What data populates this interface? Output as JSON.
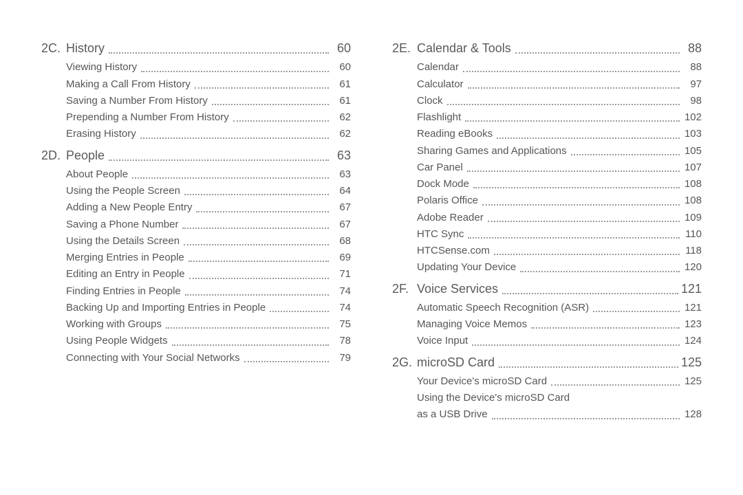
{
  "columns": [
    {
      "sections": [
        {
          "id": "2C.",
          "title": "History",
          "page": "60",
          "entries": [
            {
              "label": "Viewing History",
              "page": "60"
            },
            {
              "label": "Making a Call From History",
              "page": "61"
            },
            {
              "label": "Saving a Number From History",
              "page": "61"
            },
            {
              "label": "Prepending a Number From History",
              "page": "62"
            },
            {
              "label": "Erasing History",
              "page": "62"
            }
          ]
        },
        {
          "id": "2D.",
          "title": "People",
          "page": "63",
          "entries": [
            {
              "label": "About People",
              "page": "63"
            },
            {
              "label": "Using the People Screen",
              "page": "64"
            },
            {
              "label": "Adding a New People Entry",
              "page": "67"
            },
            {
              "label": "Saving a Phone Number",
              "page": "67"
            },
            {
              "label": "Using the Details Screen",
              "page": "68"
            },
            {
              "label": "Merging Entries in People",
              "page": "69"
            },
            {
              "label": "Editing an Entry in People",
              "page": "71"
            },
            {
              "label": "Finding Entries in People",
              "page": "74"
            },
            {
              "label": "Backing Up and Importing Entries in People",
              "page": "74"
            },
            {
              "label": "Working with Groups",
              "page": "75"
            },
            {
              "label": "Using People Widgets",
              "page": "78"
            },
            {
              "label": "Connecting with Your Social Networks",
              "page": "79"
            }
          ]
        }
      ]
    },
    {
      "sections": [
        {
          "id": "2E.",
          "title": "Calendar & Tools",
          "page": "88",
          "entries": [
            {
              "label": "Calendar",
              "page": "88"
            },
            {
              "label": "Calculator",
              "page": "97"
            },
            {
              "label": "Clock",
              "page": "98"
            },
            {
              "label": "Flashlight",
              "page": "102"
            },
            {
              "label": "Reading eBooks",
              "page": "103"
            },
            {
              "label": "Sharing Games and Applications",
              "page": "105"
            },
            {
              "label": "Car Panel",
              "page": "107"
            },
            {
              "label": "Dock Mode",
              "page": "108"
            },
            {
              "label": "Polaris Office",
              "page": "108"
            },
            {
              "label": "Adobe Reader",
              "page": "109"
            },
            {
              "label": "HTC Sync",
              "page": "110"
            },
            {
              "label": "HTCSense.com",
              "page": "118"
            },
            {
              "label": "Updating Your Device",
              "page": "120"
            }
          ]
        },
        {
          "id": "2F.",
          "title": "Voice Services",
          "page": "121",
          "entries": [
            {
              "label": "Automatic Speech Recognition (ASR)",
              "page": "121"
            },
            {
              "label": "Managing Voice Memos",
              "page": "123"
            },
            {
              "label": "Voice Input",
              "page": "124"
            }
          ]
        },
        {
          "id": "2G.",
          "title": "microSD Card",
          "page": "125",
          "entries": [
            {
              "label": "Your Device's microSD Card",
              "page": "125"
            },
            {
              "label": "Using the Device's microSD Card",
              "label2": "as a USB Drive",
              "page": "128"
            }
          ]
        }
      ]
    }
  ]
}
